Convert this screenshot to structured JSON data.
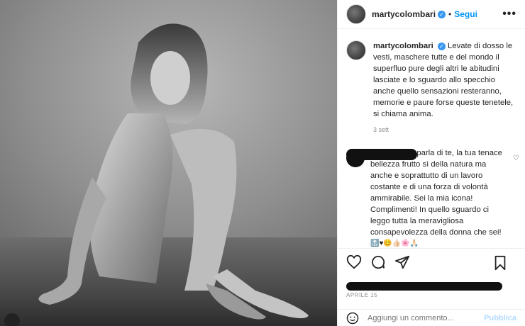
{
  "post": {
    "username": "martycolombari",
    "follow_label": "Segui",
    "more_label": "•••",
    "caption_user": "martycolombari",
    "caption_text": "Levate di dosso le vesti, maschere tutte e del mondo il superfluo pure degli altri le abitudini lasciate e lo sguardo allo specchio anche quello sensazioni resteranno, memorie e paure forse queste tenetele, si chiama anima.",
    "caption_time": "3 sett"
  },
  "comment": {
    "text": "una foto che parla di te, la tua tenace bellezza frutto sì della natura ma anche e soprattutto di un lavoro costante e di una forza di volontà ammirabile. Sei la mia icona! Complimenti! In quello sguardo ci leggo tutta la meravigliosa consapevolezza della donna che sei!",
    "emojis": "🔝♥😊👍🏻🌸🙏🏻"
  },
  "footer": {
    "date": "APRILE 15",
    "add_comment_placeholder": "Aggiungi un commento...",
    "publish_label": "Pubblica"
  },
  "icons": [
    "heart-icon",
    "comment-icon",
    "share-icon",
    "bookmark-icon",
    "emoji-icon",
    "more-icon",
    "verified-icon"
  ],
  "colors": {
    "follow": "#0095f6",
    "verified": "#3897f0",
    "publish_disabled": "#b3dbff"
  }
}
